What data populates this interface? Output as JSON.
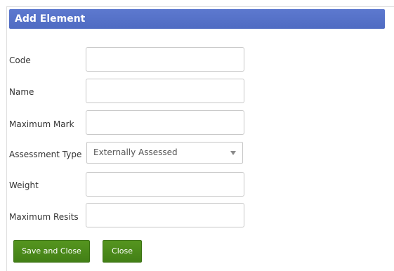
{
  "dialog": {
    "title": "Add Element"
  },
  "form": {
    "fields": [
      {
        "label": "Code",
        "value": ""
      },
      {
        "label": "Name",
        "value": ""
      },
      {
        "label": "Maximum Mark",
        "value": ""
      },
      {
        "label": "Assessment Type",
        "value": "Externally Assessed"
      },
      {
        "label": "Weight",
        "value": ""
      },
      {
        "label": "Maximum Resits",
        "value": ""
      }
    ]
  },
  "buttons": {
    "save_close": "Save and Close",
    "close": "Close"
  },
  "colors": {
    "title_bar": "#5470c6",
    "button": "#4a8a1c"
  }
}
